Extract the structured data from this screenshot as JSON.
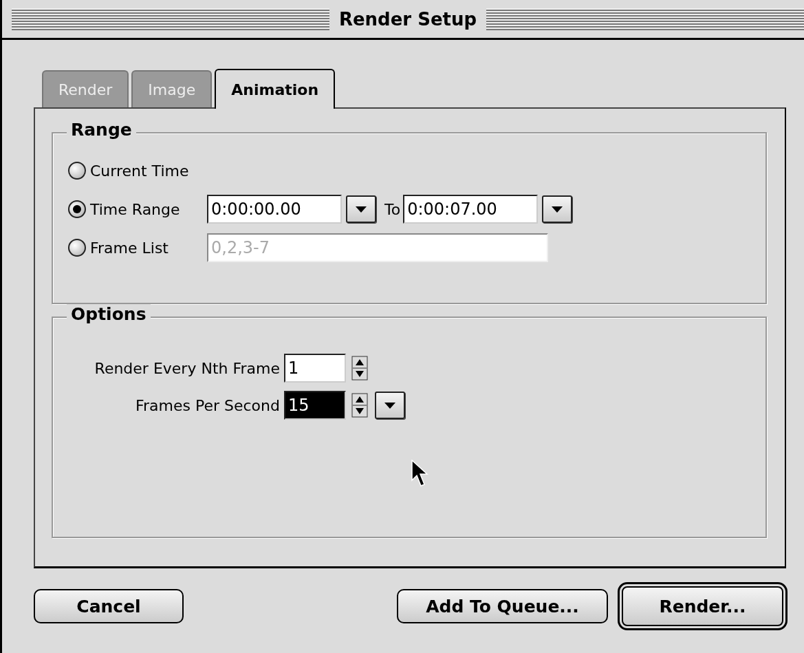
{
  "window": {
    "title": "Render Setup"
  },
  "tabs": [
    {
      "label": "Render",
      "selected": false
    },
    {
      "label": "Image",
      "selected": false
    },
    {
      "label": "Animation",
      "selected": true
    }
  ],
  "range": {
    "title": "Range",
    "options": [
      {
        "kind": "plain",
        "label": "Current Time",
        "selected": false
      },
      {
        "kind": "time_range",
        "label": "Time Range",
        "selected": true,
        "from": "0:00:00.00",
        "to_label": "To",
        "to": "0:00:07.00"
      },
      {
        "kind": "list",
        "label": "Frame List",
        "selected": false,
        "value": "0,2,3-7",
        "disabled": true
      }
    ]
  },
  "options": {
    "title": "Options",
    "rows": [
      {
        "kind": "stepper",
        "label": "Render Every Nth Frame",
        "value": "1",
        "selected": false
      },
      {
        "kind": "stepper_menu",
        "label": "Frames Per Second",
        "value": "15",
        "selected": true
      }
    ]
  },
  "buttons": [
    {
      "label": "Cancel",
      "default": false
    },
    {
      "label": "Add To Queue...",
      "default": false
    },
    {
      "label": "Render...",
      "default": true
    }
  ]
}
